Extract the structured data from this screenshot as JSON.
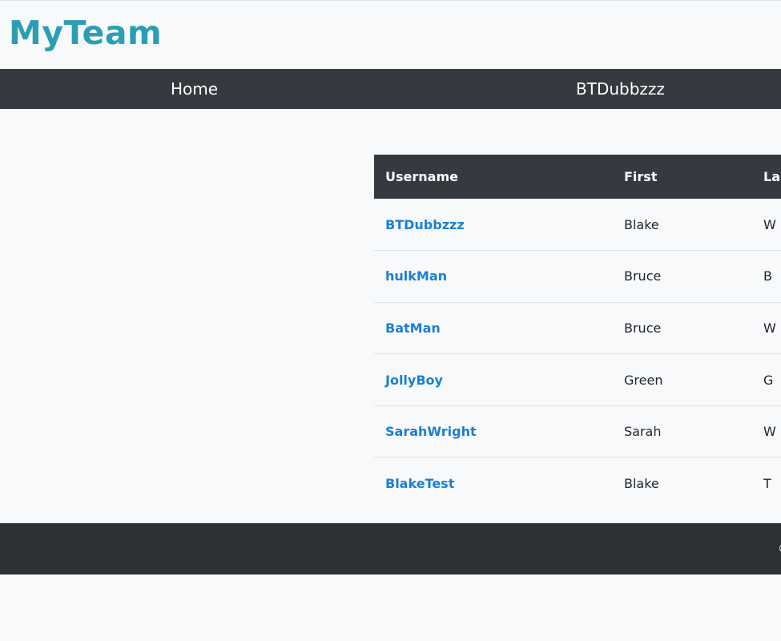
{
  "brand": "MyTeam",
  "nav": {
    "home": "Home",
    "user": "BTDubbzzz"
  },
  "table": {
    "headers": [
      "Username",
      "First",
      "Last"
    ],
    "rows": [
      {
        "username": "BTDubbzzz",
        "first": "Blake",
        "last": "W"
      },
      {
        "username": "hulkMan",
        "first": "Bruce",
        "last": "B"
      },
      {
        "username": "BatMan",
        "first": "Bruce",
        "last": "W"
      },
      {
        "username": "JollyBoy",
        "first": "Green",
        "last": "G"
      },
      {
        "username": "SarahWright",
        "first": "Sarah",
        "last": "W"
      },
      {
        "username": "BlakeTest",
        "first": "Blake",
        "last": "T"
      }
    ]
  },
  "footer": {
    "text": "©"
  },
  "colors": {
    "brand": "#2b9eb3",
    "navbar": "#343a40",
    "link": "#1a7fd6",
    "footer": "#2d3035"
  }
}
